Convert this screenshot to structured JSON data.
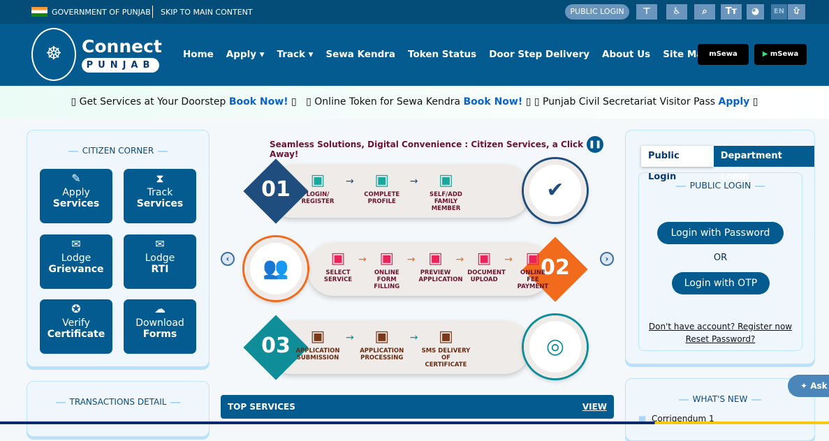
{
  "topbar": {
    "government": "GOVERNMENT OF PUNJAB",
    "skip": "SKIP TO MAIN CONTENT",
    "public_login": "PUBLIC LOGIN",
    "tools": [
      "sitemap-icon",
      "accessibility-icon",
      "search-icon",
      "text-size-icon",
      "palette-icon"
    ],
    "lang_en": "EN",
    "lang_pa": "ਪੰ"
  },
  "brand": {
    "name": "Connect",
    "sub": "PUNJAB"
  },
  "nav": {
    "items": [
      "Home",
      "Apply ▾",
      "Track ▾",
      "Sewa Kendra",
      "Token Status",
      "Door Step Delivery",
      "About Us",
      "Site Map"
    ],
    "apps": [
      "mSewa",
      "mSewa"
    ]
  },
  "ticker": {
    "t1": "Get Services at Your Doorstep ",
    "l1": "Book Now!",
    "t2": "Online Token for Sewa Kendra ",
    "l2": "Book Now!",
    "t3": "Punjab Civil Secretariat Visitor Pass ",
    "l3": "Apply",
    "box": "▯"
  },
  "citizen": {
    "title": "CITIZEN CORNER",
    "buttons": [
      {
        "top": "Apply",
        "bottom": "Services",
        "icon": "✎"
      },
      {
        "top": "Track",
        "bottom": "Services",
        "icon": "⧗"
      },
      {
        "top": "Lodge",
        "bottom": "Grievance",
        "icon": "✉"
      },
      {
        "top": "Lodge",
        "bottom": "RTI",
        "icon": "✉"
      },
      {
        "top": "Verify",
        "bottom": "Certificate",
        "icon": "✪"
      },
      {
        "top": "Download",
        "bottom": "Forms",
        "icon": "☁"
      }
    ]
  },
  "transactions": {
    "title": "TRANSACTIONS DETAIL"
  },
  "banner": {
    "tagline": "Seamless Solutions, Digital Convenience : Citizen Services, a Click Away!",
    "rows": [
      {
        "num": "01",
        "color": "#1f4e7e",
        "steps": [
          "LOGIN/ REGISTER",
          "COMPLETE PROFILE",
          "SELF/ADD FAMILY MEMBER"
        ],
        "step_color": "#6b1330"
      },
      {
        "num": "02",
        "color": "#f26a1b",
        "steps": [
          "SELECT SERVICE",
          "ONLINE FORM FILLING",
          "PREVIEW APPLICATION",
          "DOCUMENT UPLOAD",
          "ONLINE FEE PAYMENT"
        ],
        "step_color": "#6b1330"
      },
      {
        "num": "03",
        "color": "#0f8e99",
        "steps": [
          "APPLICATION SUBMISSION",
          "APPLICATION PROCESSING",
          "SMS DELIVERY OF CERTIFICATE"
        ],
        "step_color": "#6b2a10"
      }
    ]
  },
  "top_services": {
    "title": "TOP SERVICES",
    "view": "VIEW"
  },
  "login": {
    "tab_public": "Public Login",
    "tab_dept": "Department Login",
    "title": "PUBLIC LOGIN",
    "password": "Login with Password",
    "or": "OR",
    "otp": "Login with OTP",
    "register": "Don't have account? Register now",
    "reset": "Reset Password?"
  },
  "whats_new": {
    "title": "WHAT'S NEW",
    "items": [
      "Corrigendum 1"
    ]
  },
  "ask": "Ask"
}
